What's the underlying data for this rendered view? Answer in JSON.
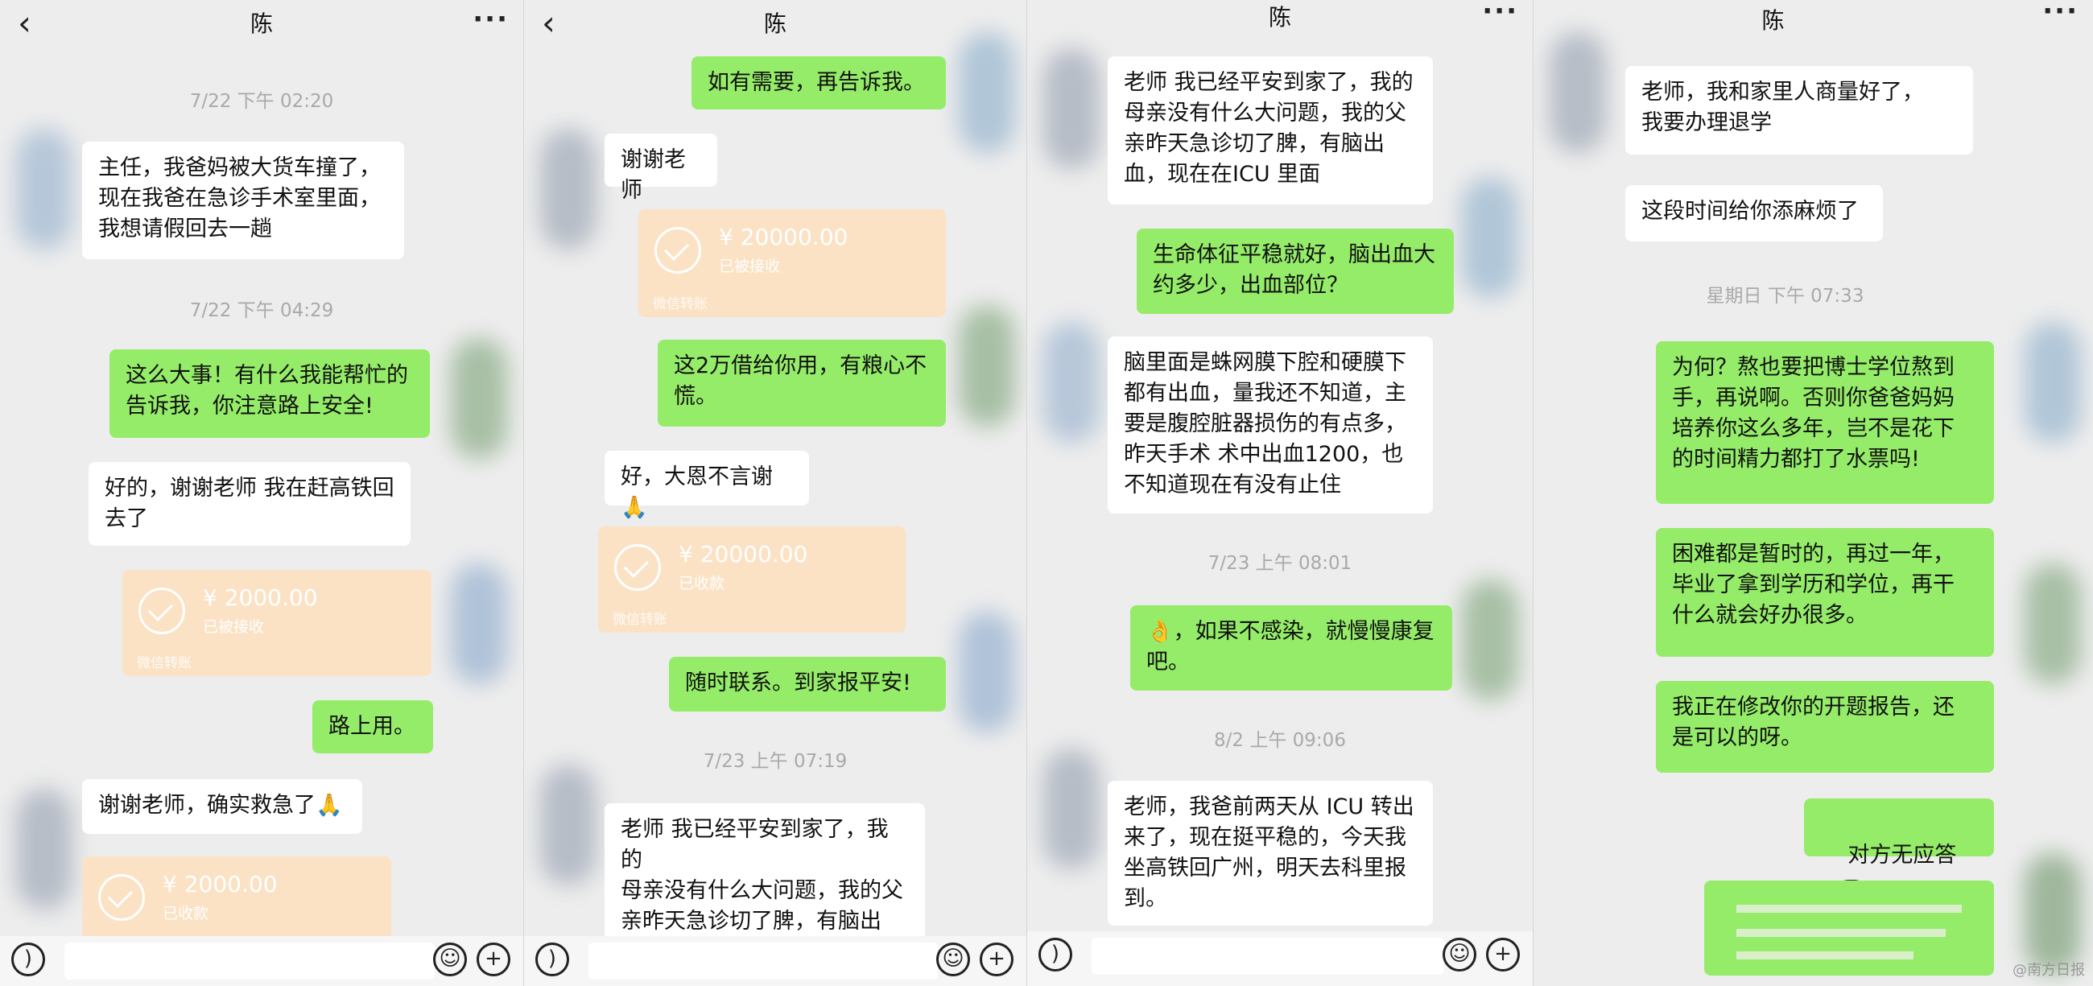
{
  "panels": [
    {
      "header": {
        "back_icon": "‹",
        "title": "陈",
        "more_icon": "···"
      },
      "items": {
        "ts1": "7/22 下午 02:20",
        "m1": "主任，我爸妈被大货车撞了，\n现在我爸在急诊手术室里面，\n我想请假回去一趟",
        "ts2": "7/22 下午 04:29",
        "m2": "这么大事！有什么我能帮忙的\n告诉我，你注意路上安全!",
        "m3": "好的，谢谢老师 我在赶高铁回\n去了",
        "t1_amount": "¥ 2000.00",
        "t1_status": "已被接收",
        "t1_footer": "微信转账",
        "m4": "路上用。",
        "m5": "谢谢老师，确实救急了🙏",
        "t2_amount": "¥ 2000.00",
        "t2_status": "已收款"
      }
    },
    {
      "header": {
        "back_icon": "‹",
        "title": "陈",
        "more_icon": ""
      },
      "items": {
        "m1": "如有需要，再告诉我。",
        "m2": "谢谢老师",
        "t1_amount": "¥ 20000.00",
        "t1_status": "已被接收",
        "t1_footer": "微信转账",
        "m3": "这2万借给你用，有粮心不\n慌。",
        "m4": "好，大恩不言谢🙏",
        "t2_amount": "¥ 20000.00",
        "t2_status": "已收款",
        "t2_footer": "微信转账",
        "m5": "随时联系。到家报平安!",
        "ts1": "7/23 上午 07:19",
        "m6": "老师 我已经平安到家了，我的\n母亲没有什么大问题，我的父\n亲昨天急诊切了脾，有脑出\n血，现在在ICU 里面"
      }
    },
    {
      "header": {
        "back_icon": "",
        "title": "陈",
        "more_icon": "···"
      },
      "items": {
        "m1": "老师 我已经平安到家了，我的\n母亲没有什么大问题，我的父\n亲昨天急诊切了脾，有脑出\n血，现在在ICU 里面",
        "m2": "生命体征平稳就好，脑出血大\n约多少，出血部位？",
        "m3": "脑里面是蛛网膜下腔和硬膜下\n都有出血，量我还不知道，主\n要是腹腔脏器损伤的有点多，\n昨天手术 术中出血1200，也\n不知道现在有没有止住",
        "ts1": "7/23 上午 08:01",
        "m4": "👌，如果不感染，就慢慢康复\n吧。",
        "ts2": "8/2 上午 09:06",
        "m5": "老师，我爸前两天从 ICU 转出\n来了，现在挺平稳的，今天我\n坐高铁回广州，明天去科里报\n到。"
      }
    },
    {
      "header": {
        "back_icon": "",
        "title": "陈",
        "more_icon": "···"
      },
      "items": {
        "m1": "老师，我和家里人商量好了，\n我要办理退学",
        "m2": "这段时间给你添麻烦了",
        "ts1": "星期日 下午 07:33",
        "m3": "为何？熬也要把博士学位熬到\n手，再说啊。否则你爸爸妈妈\n培养你这么多年，岂不是花下\n的时间精力都打了水票吗!",
        "m4": "困难都是暂时的，再过一年，\n毕业了拿到学历和学位，再干\n什么就会好办很多。",
        "m5": "我正在修改你的开题报告，还\n是可以的呀。",
        "m6": "对方无应答"
      }
    }
  ],
  "watermark": "@南方日报",
  "colors": {
    "outgoing": "#95ec69",
    "incoming": "#ffffff",
    "transfer": "#fbe2c5",
    "background": "#ededed"
  }
}
